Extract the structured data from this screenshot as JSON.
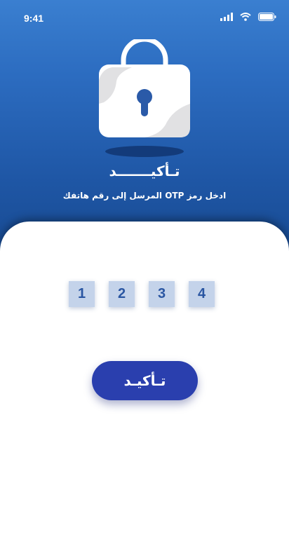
{
  "status": {
    "time": "9:41"
  },
  "header": {
    "title": "تـأكيـــــــد",
    "subtitle": "ادخل رمز OTP المرسل إلى رقم هاتفك"
  },
  "otp": {
    "digits": [
      "1",
      "2",
      "3",
      "4"
    ]
  },
  "actions": {
    "confirm_label": "تـأكيـد"
  },
  "colors": {
    "header_top": "#3a7fd0",
    "header_bottom": "#184b93",
    "button": "#2a3fae",
    "otp_box": "#c4d3ea",
    "otp_digit": "#2a56a2"
  },
  "icons": [
    "signal-icon",
    "wifi-icon",
    "battery-icon",
    "padlock-icon"
  ]
}
